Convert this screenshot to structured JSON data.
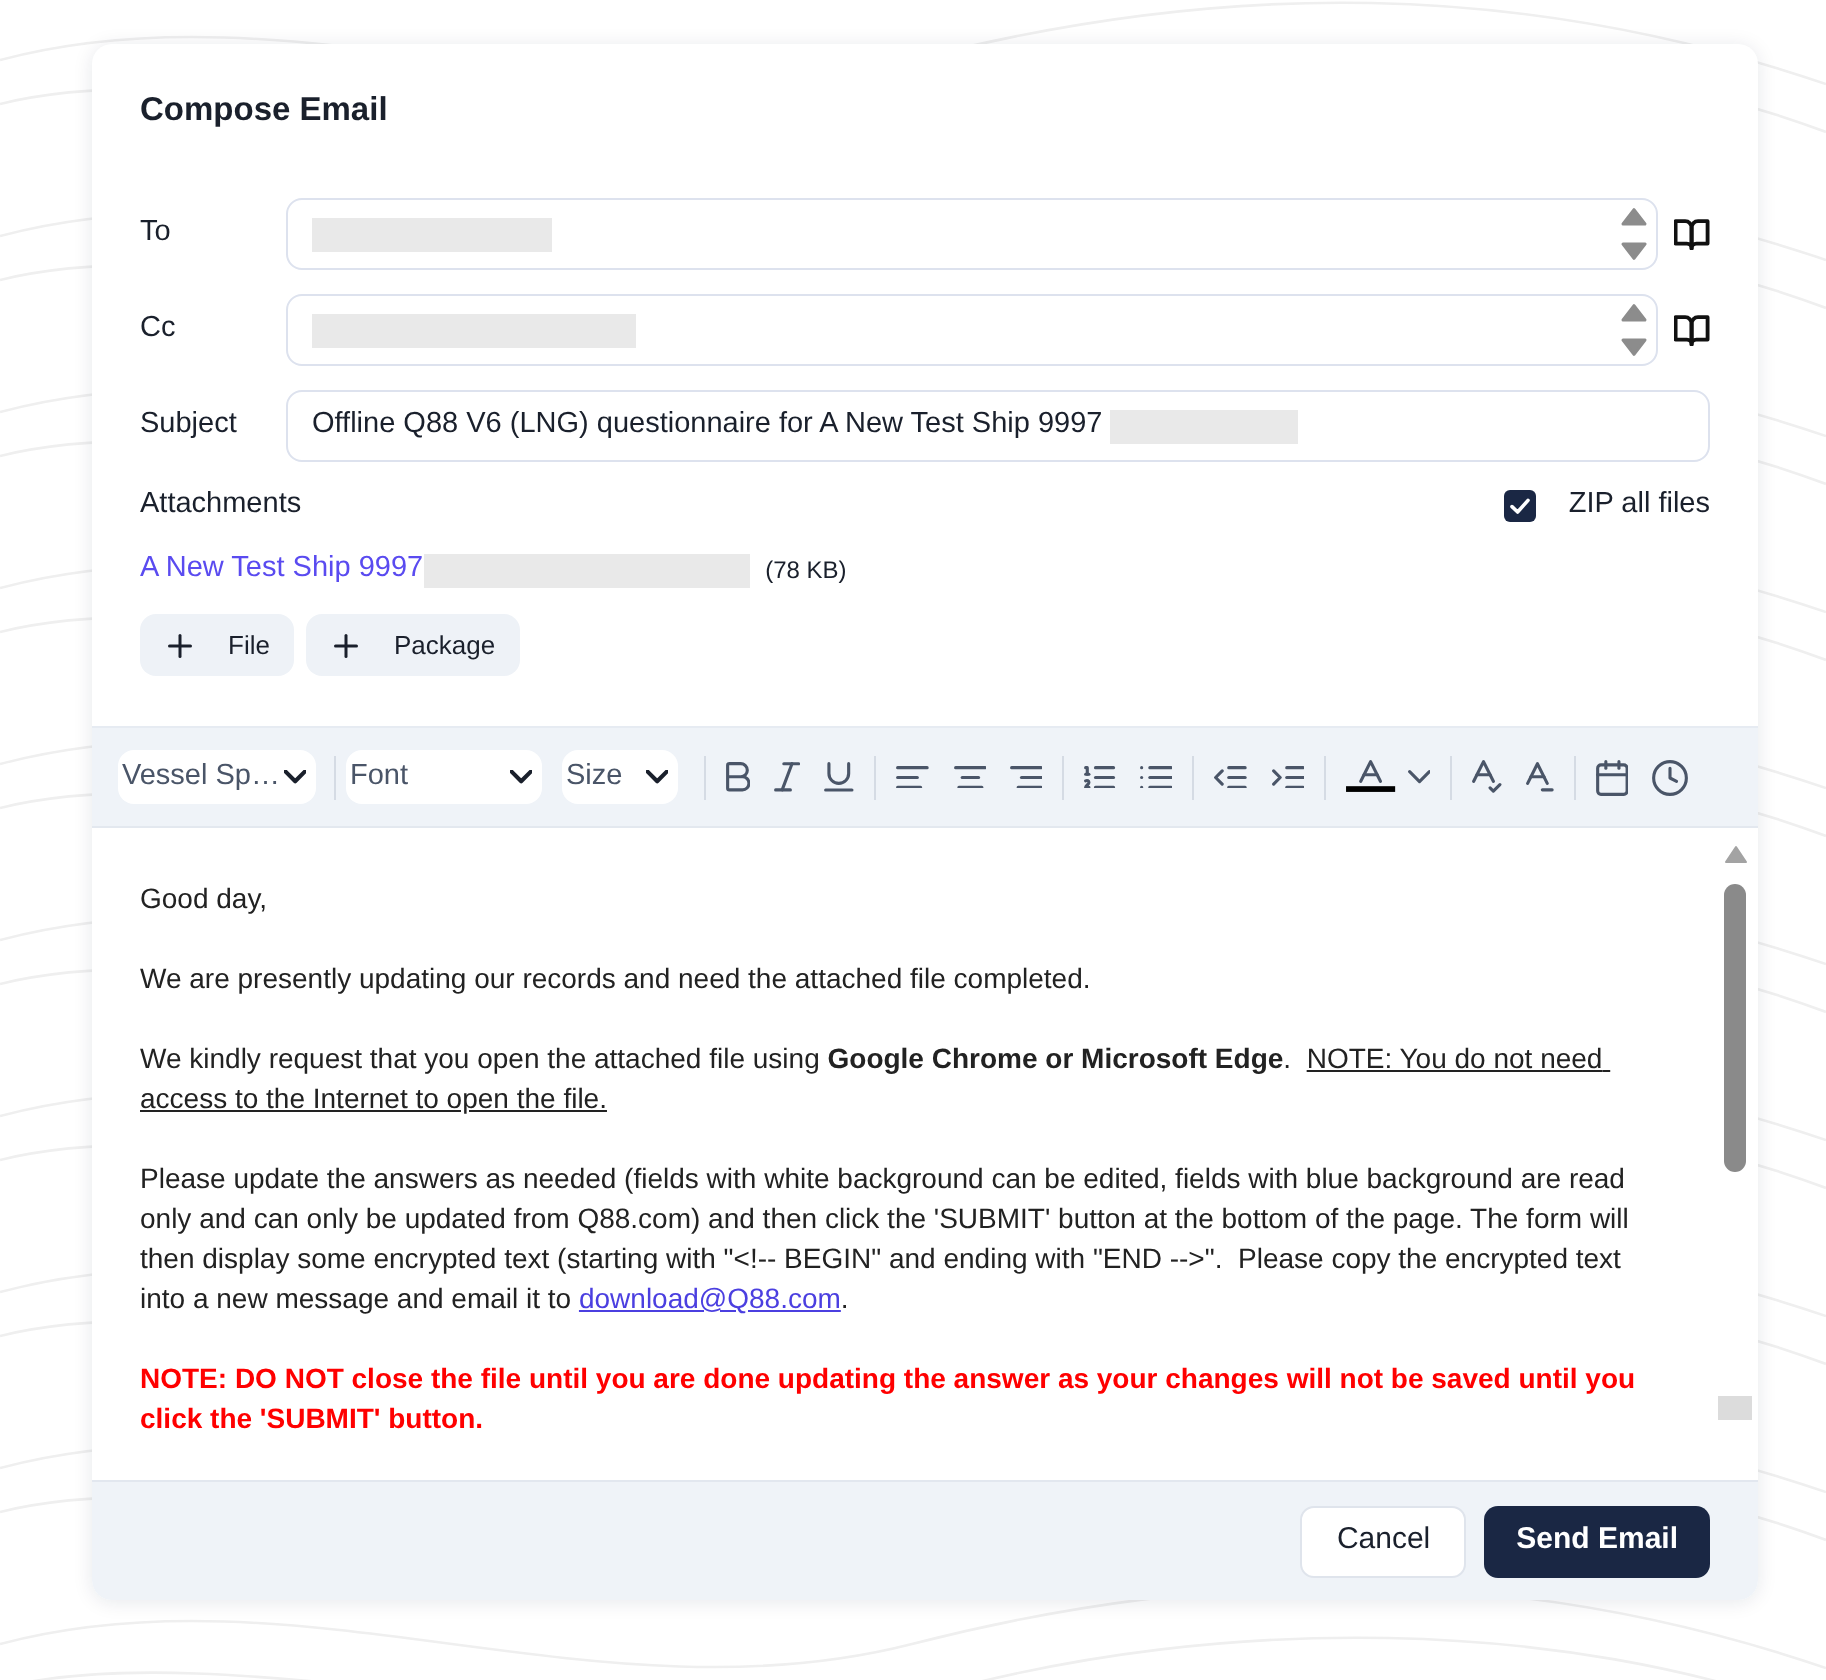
{
  "dialog": {
    "title": "Compose Email"
  },
  "fields": [
    {
      "kind": "address",
      "label": "To",
      "redacted": true
    },
    {
      "kind": "address",
      "label": "Cc",
      "redacted": true
    },
    {
      "kind": "text",
      "label": "Subject",
      "value": "Offline Q88 V6 (LNG) questionnaire for A New Test Ship 9997",
      "redacted": true
    }
  ],
  "attachments": {
    "label": "Attachments",
    "zip_all": {
      "label": "ZIP all files",
      "checked": true
    },
    "files": [
      {
        "name": "A New Test Ship 9997",
        "redacted": true,
        "size": "(78 KB)"
      }
    ],
    "add_buttons": [
      "File",
      "Package"
    ]
  },
  "toolbar": {
    "dropdowns": [
      "Vessel Sp…",
      "Font",
      "Size"
    ]
  },
  "message": {
    "paragraphs": [
      {
        "kind": "normal",
        "runs": [
          {
            "kind": "plain",
            "text": "Good day,"
          }
        ]
      },
      {
        "kind": "normal",
        "runs": [
          {
            "kind": "plain",
            "text": "We are presently updating our records and need the attached file completed."
          }
        ]
      },
      {
        "kind": "normal",
        "runs": [
          {
            "kind": "plain",
            "text": "We kindly request that you open the attached file using "
          },
          {
            "kind": "bold",
            "text": "Google Chrome or Microsoft Edge"
          },
          {
            "kind": "plain",
            "text": ".  "
          },
          {
            "kind": "underline",
            "text": "NOTE: You do not need access to the Internet to open the file."
          }
        ]
      },
      {
        "kind": "normal",
        "runs": [
          {
            "kind": "plain",
            "text": "Please update the answers as needed (fields with white background can be edited, fields with blue background are read only and can only be updated from Q88.com) and then click the 'SUBMIT' button at the bottom of the page. The form will then display some encrypted text (starting with \"<!-- BEGIN\" and ending with \"END -->\".  Please copy the encrypted text into a new message and email it to "
          },
          {
            "kind": "link",
            "text": "download@Q88.com"
          },
          {
            "kind": "plain",
            "text": "."
          }
        ]
      },
      {
        "kind": "warning",
        "runs": [
          {
            "kind": "plain",
            "text": "NOTE: DO NOT close the file until you are done updating the answer as your changes will not be saved until you click the 'SUBMIT' button."
          }
        ]
      }
    ]
  },
  "footer": {
    "buttons": [
      {
        "kind": "secondary",
        "label": "Cancel"
      },
      {
        "kind": "primary",
        "label": "Send Email"
      }
    ]
  }
}
